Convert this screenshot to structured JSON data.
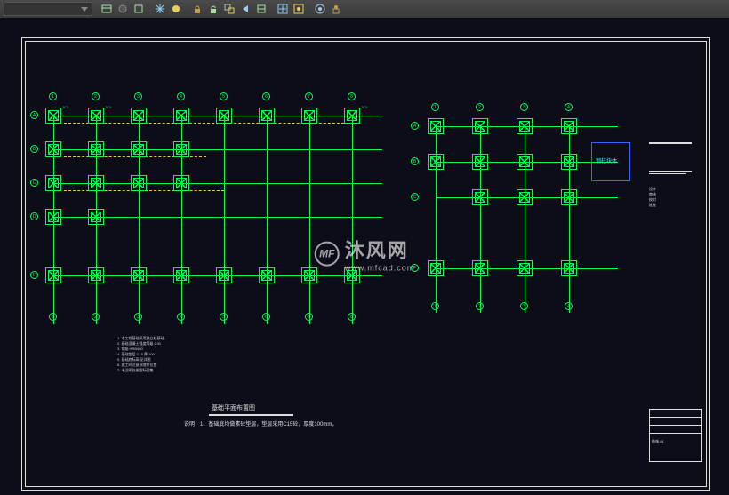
{
  "toolbar": {
    "dropdown_value": "",
    "icons": [
      "layer-states",
      "layer-off",
      "layer-iso",
      "freeze",
      "thaw",
      "lock",
      "unlock",
      "match",
      "prev-layer",
      "layer-walk",
      "vp-freeze",
      "vp-thaw",
      "isolate",
      "unisolate"
    ]
  },
  "gridlines": {
    "left_x": [
      "1",
      "2",
      "3",
      "4",
      "5",
      "6",
      "7",
      "8"
    ],
    "left_y": [
      "A",
      "B",
      "C",
      "D",
      "F"
    ],
    "right_x": [
      "1",
      "2",
      "3",
      "4"
    ],
    "right_y": [
      "A",
      "B",
      "C",
      "F"
    ]
  },
  "footings": {
    "tag": "JC1"
  },
  "legend": {
    "label": "钢柱块体"
  },
  "drawing": {
    "title": "基础平面布置图",
    "subtitle": "说明：1、基础底均做素砼垫层，垫层采用C15砼，厚度100mm。"
  },
  "notes_text": "1. 本工程基础采用独立柱基础...\n2. 基础混凝土强度等级 C30\n3. 钢筋 HRB400\n4. 基础垫层 C15 厚 100\n5. 基础底标高 见详图\n6. 施工时注意预埋件位置\n7. 未注明处按国标图集",
  "watermark": {
    "brand": "沐风网",
    "url": "www.mfcad.com",
    "logo_text": "MF"
  },
  "titleblock": {
    "lines": [
      "设计",
      "审核",
      "校对",
      "批准"
    ],
    "drawing_no": "结施-01"
  }
}
